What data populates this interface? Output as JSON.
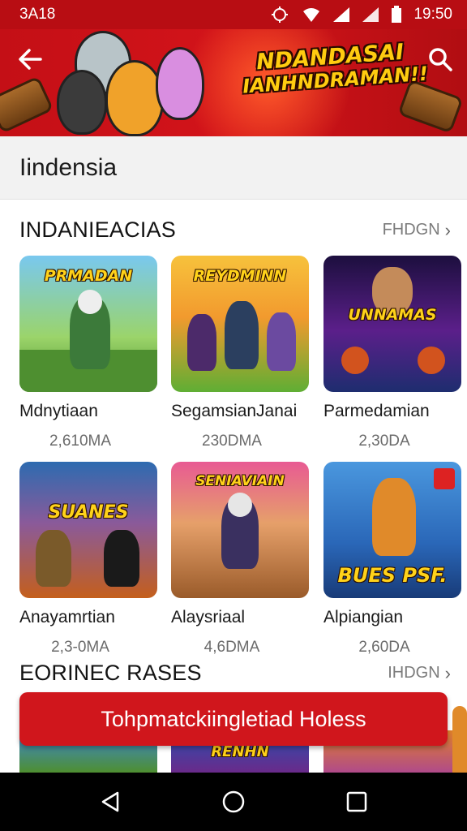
{
  "status_bar": {
    "left_text": "3A18",
    "time": "19:50"
  },
  "banner": {
    "title_line1": "NDANDASAI",
    "title_line2": "IANHNDRAMAN!!"
  },
  "search": {
    "value": "Iindensia"
  },
  "section1": {
    "title": "INDANIEACIAS",
    "more_label": "FHDGN",
    "cards": [
      {
        "name": "Mdnytiaan",
        "meta": "2,610MA",
        "thumb_title": "PRMADAN",
        "colors": [
          "#6fc2e8",
          "#4a9a2c"
        ]
      },
      {
        "name": "SegamsianJanai",
        "meta": "230DMA",
        "thumb_title": "REYDMINN",
        "colors": [
          "#f39b2a",
          "#5ba532"
        ]
      },
      {
        "name": "Parmedamian",
        "meta": "2,30DA",
        "thumb_title": "UNNAMAS",
        "colors": [
          "#3a1b6e",
          "#8b2fb8"
        ]
      }
    ]
  },
  "section1_row2": {
    "cards": [
      {
        "name": "Anayamrtian",
        "meta": "2,3-0MA",
        "thumb_title": "SUANES",
        "colors": [
          "#2f6fb3",
          "#c85a1a"
        ]
      },
      {
        "name": "Alaysriaal",
        "meta": "4,6DMA",
        "thumb_title": "SENIAVIAIN",
        "colors": [
          "#e24a8a",
          "#a8612a"
        ]
      },
      {
        "name": "Alpiangian",
        "meta": "2,60DA",
        "thumb_title": "BUES PSF.",
        "colors": [
          "#3d86d4",
          "#1d3e8a"
        ]
      }
    ]
  },
  "section2": {
    "title": "EORINEC RASES",
    "more_label": "IHDGN"
  },
  "cta": {
    "label": "Tohpmatckiingletiad Holess"
  },
  "partial_thumb": {
    "title": "RENHN"
  }
}
